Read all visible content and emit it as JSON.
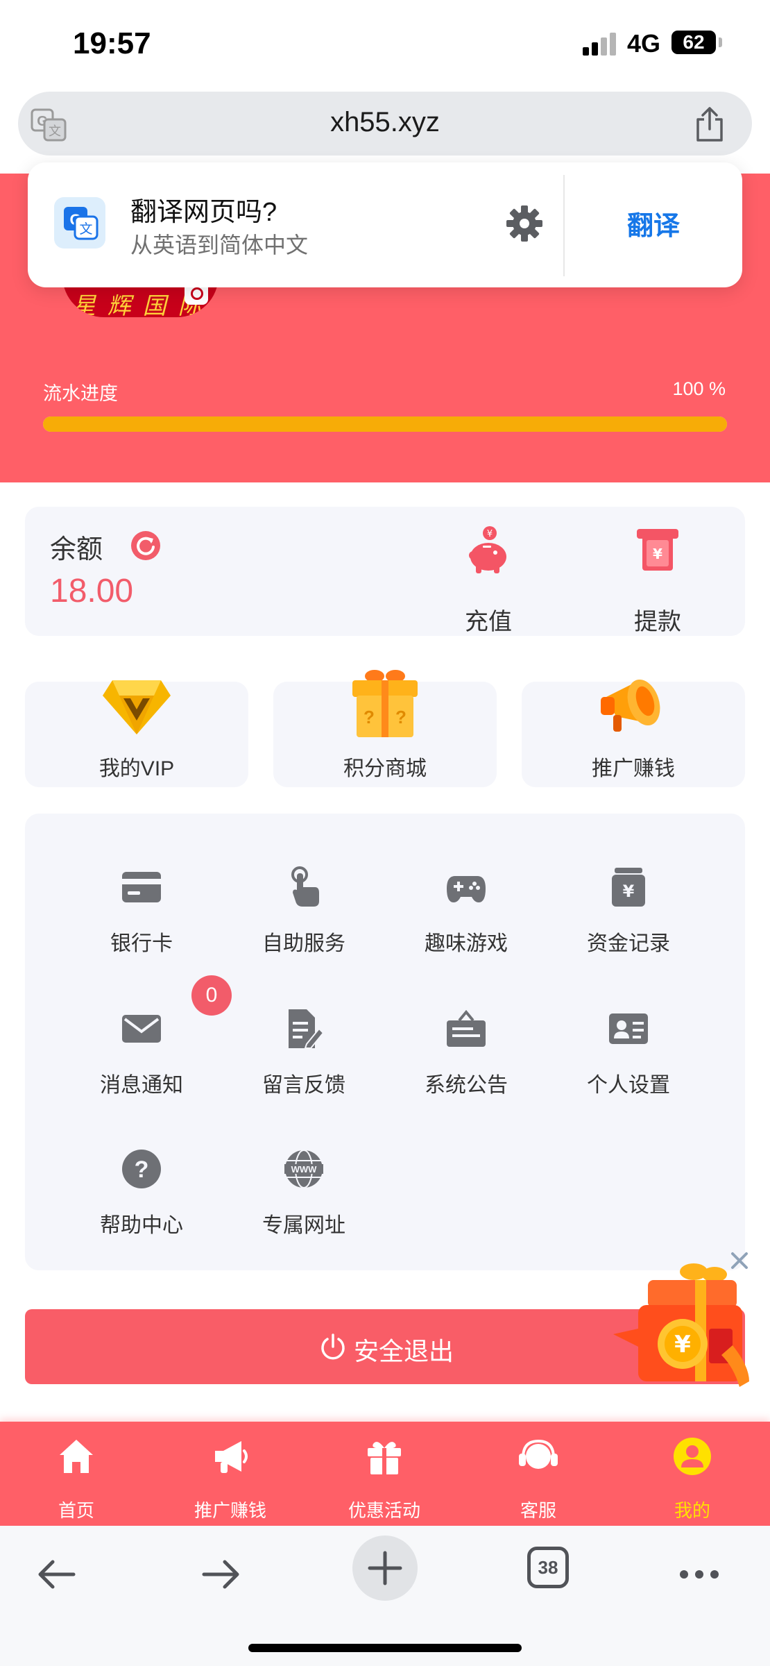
{
  "status_bar": {
    "time": "19:57",
    "network": "4G",
    "battery": "62"
  },
  "browser": {
    "url": "xh55.xyz",
    "tabs_count": "38"
  },
  "translate_popup": {
    "title": "翻译网页吗?",
    "subtitle": "从英语到简体中文",
    "action": "翻译"
  },
  "progress": {
    "label": "流水进度",
    "value_text": "100 %",
    "percent": 100
  },
  "balance": {
    "label": "余额",
    "value": "18.00"
  },
  "quick_actions": [
    {
      "label": "充值",
      "icon": "piggy-bank-icon"
    },
    {
      "label": "提款",
      "icon": "withdraw-icon"
    }
  ],
  "features": [
    {
      "label": "我的VIP",
      "icon": "vip-diamond-icon"
    },
    {
      "label": "积分商城",
      "icon": "mystery-box-icon"
    },
    {
      "label": "推广赚钱",
      "icon": "megaphone-icon"
    }
  ],
  "menu": [
    {
      "label": "银行卡",
      "icon": "bank-card-icon"
    },
    {
      "label": "自助服务",
      "icon": "touch-hand-icon"
    },
    {
      "label": "趣味游戏",
      "icon": "gamepad-icon"
    },
    {
      "label": "资金记录",
      "icon": "funds-record-icon"
    },
    {
      "label": "消息通知",
      "icon": "envelope-icon"
    },
    {
      "label": "留言反馈",
      "icon": "feedback-doc-icon"
    },
    {
      "label": "系统公告",
      "icon": "notice-board-icon"
    },
    {
      "label": "个人设置",
      "icon": "id-card-icon"
    },
    {
      "label": "帮助中心",
      "icon": "help-icon"
    },
    {
      "label": "专属网址",
      "icon": "www-globe-icon"
    }
  ],
  "message_badge": "0",
  "logout": {
    "label": "安全退出"
  },
  "tabbar": [
    {
      "label": "首页",
      "icon": "home-icon",
      "active": false
    },
    {
      "label": "推广赚钱",
      "icon": "megaphone-icon",
      "active": false
    },
    {
      "label": "优惠活动",
      "icon": "gift-icon",
      "active": false
    },
    {
      "label": "客服",
      "icon": "headset-icon",
      "active": false
    },
    {
      "label": "我的",
      "icon": "user-icon",
      "active": true
    }
  ],
  "colors": {
    "brand_red": "#ff5f67",
    "accent_yellow": "#f7ac07",
    "link_blue": "#1677e8",
    "balance_red": "#f25c6a",
    "active_tab": "#ffe100"
  }
}
